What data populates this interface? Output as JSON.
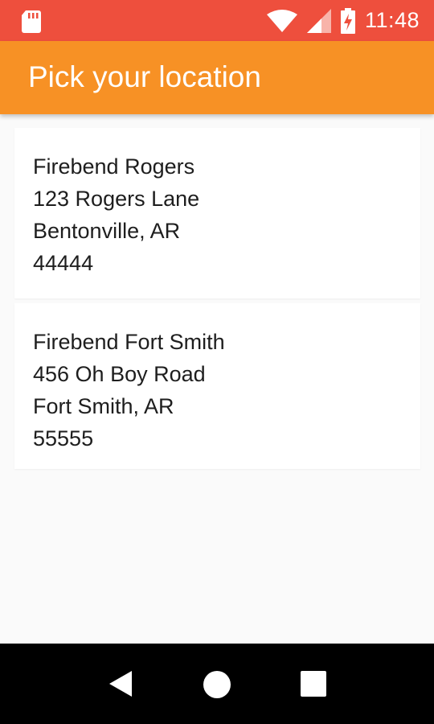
{
  "status_bar": {
    "time": "11:48",
    "icons": [
      "sd-card-icon",
      "wifi-icon",
      "cell-signal-icon",
      "battery-charging-icon"
    ],
    "background": "#ee4f3d"
  },
  "app_bar": {
    "title": "Pick your location",
    "background": "#f79125"
  },
  "locations": [
    {
      "name": "Firebend Rogers",
      "street": "123 Rogers Lane",
      "city_state": "Bentonville, AR",
      "zip": "44444"
    },
    {
      "name": "Firebend Fort Smith",
      "street": "456 Oh Boy Road",
      "city_state": "Fort Smith, AR",
      "zip": "55555"
    }
  ],
  "nav_bar": {
    "buttons": [
      "back-icon",
      "home-icon",
      "recents-icon"
    ]
  }
}
